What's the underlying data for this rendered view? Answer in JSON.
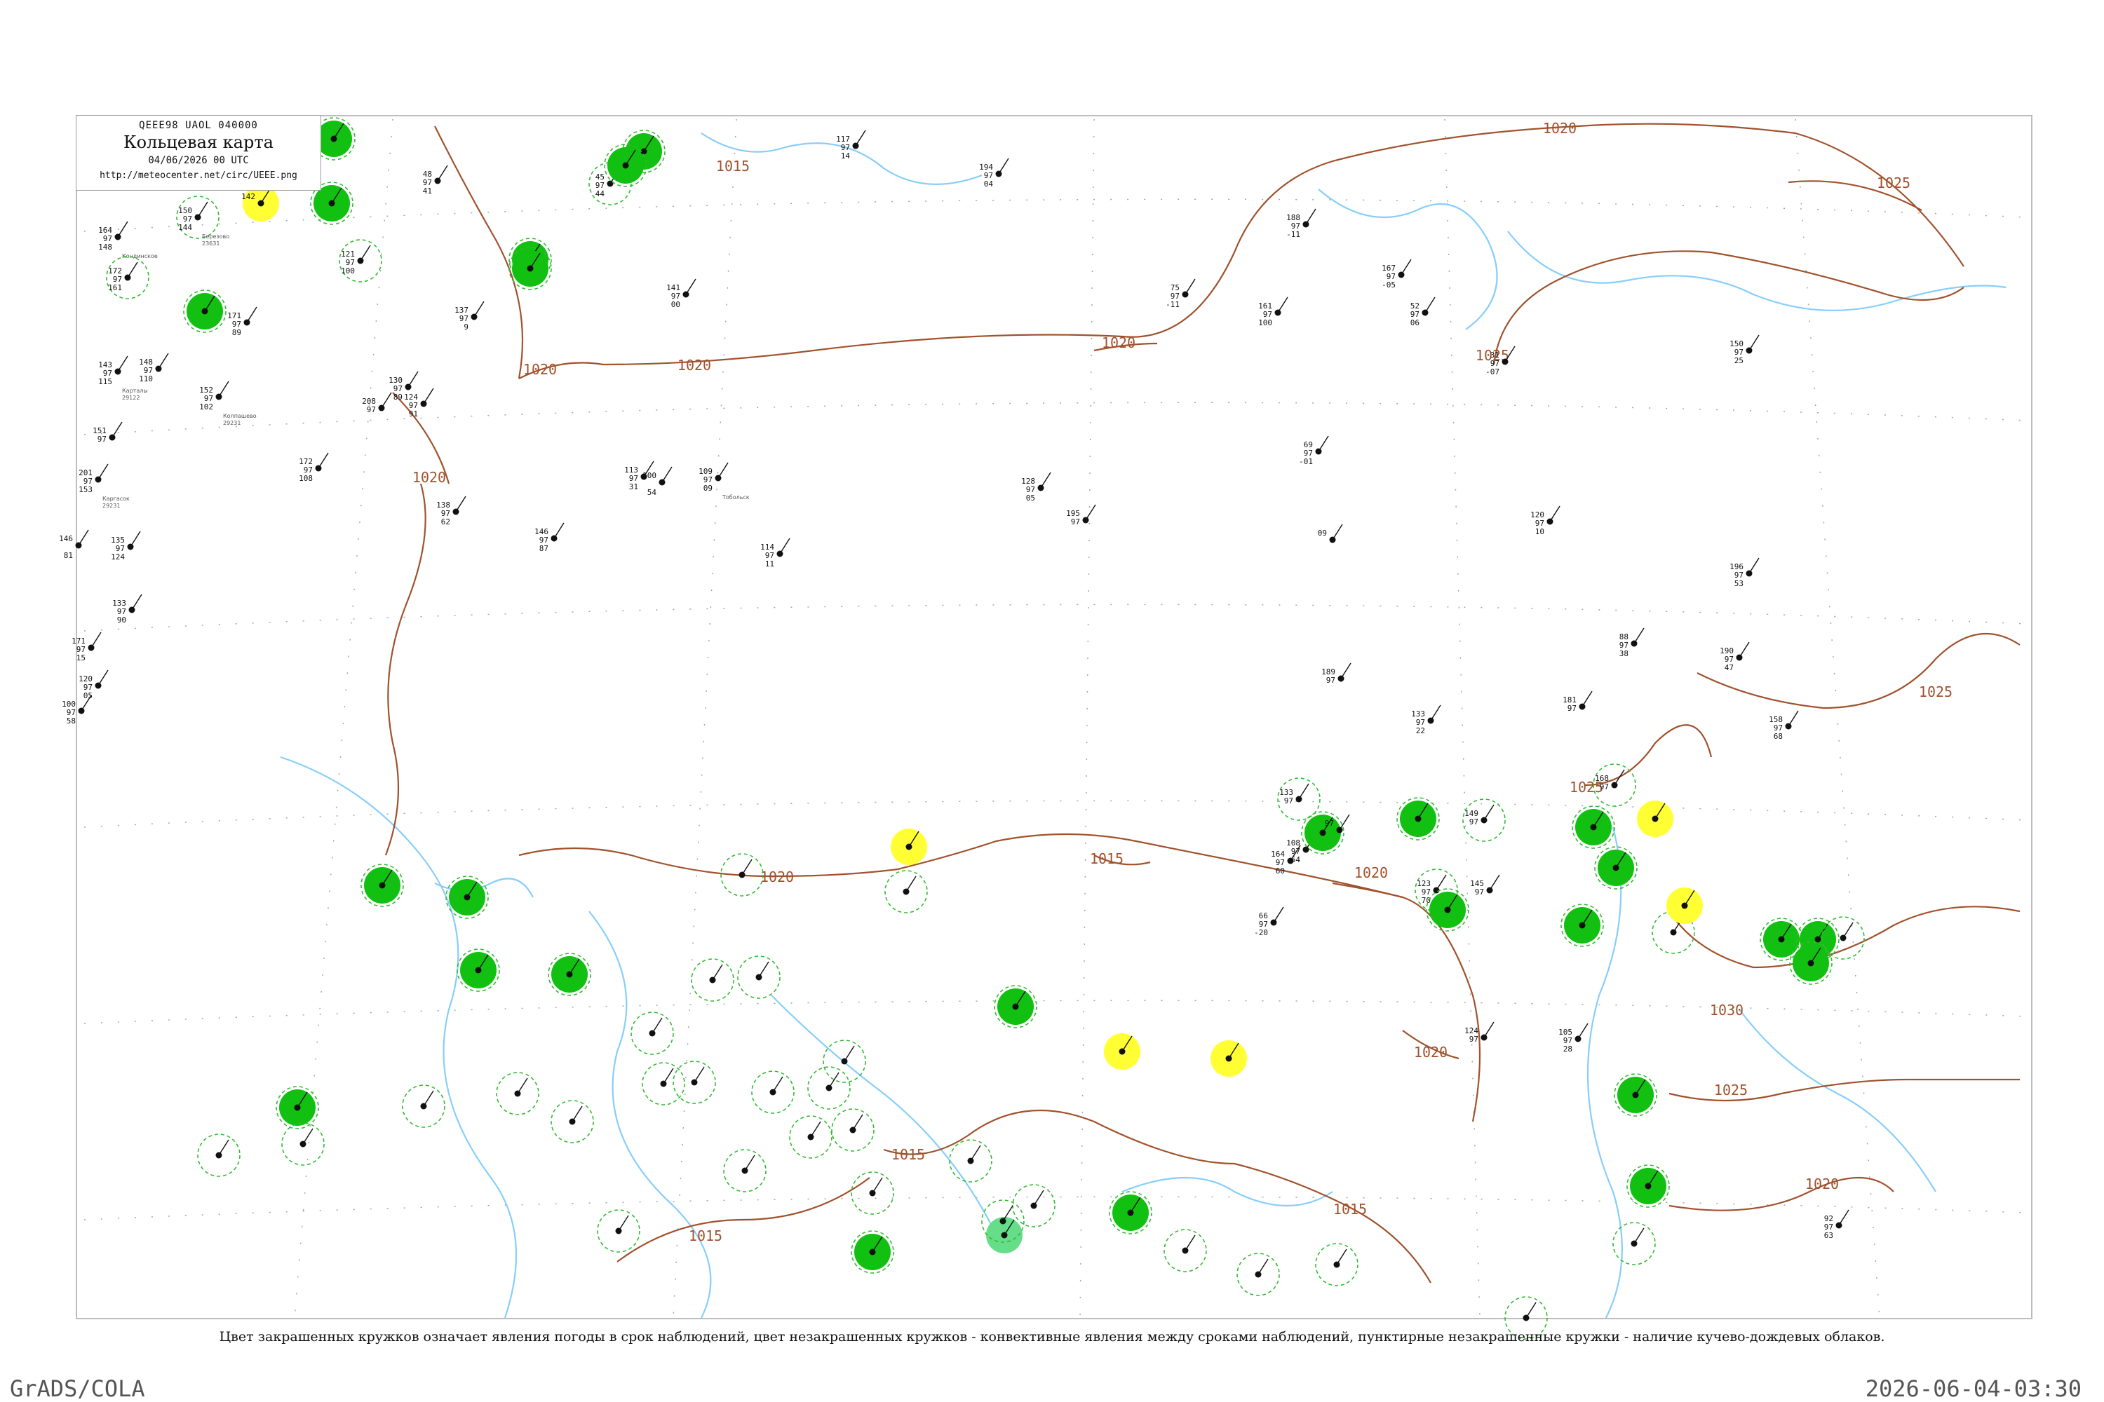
{
  "header": {
    "code": "QEEE98  UAOL  040000",
    "name": "Кольцевая карта",
    "date": "04/06/2026 00 UTC",
    "url": "http://meteocenter.net/circ/UEEE.png"
  },
  "caption": "Цвет закрашенных кружков означает явления погоды в срок наблюдений, цвет незакрашенных кружков - конвективные явления между сроками наблюдений, пунктирные незакрашенные кружки - наличие кучево-дождевых облаков.",
  "footer": {
    "left": "GrADS/COLA",
    "right": "2026-06-04-03:30"
  },
  "colors": {
    "isobar": "#a0522d",
    "river": "#87cefa",
    "rain_fill": "#11c011",
    "fog_fill": "#ffff33",
    "shower_fill": "#66dd88",
    "cb_ring": "#33bb33"
  },
  "isobars": [
    {
      "label": "1015"
    },
    {
      "label": "1020"
    },
    {
      "label": "1020"
    },
    {
      "label": "1020"
    },
    {
      "label": "1020"
    },
    {
      "label": "1020"
    },
    {
      "label": "1025"
    },
    {
      "label": "1025"
    },
    {
      "label": "1025"
    },
    {
      "label": "1025"
    },
    {
      "label": "1030"
    },
    {
      "label": "1025"
    },
    {
      "label": "1020"
    },
    {
      "label": "1020"
    },
    {
      "label": "1015"
    },
    {
      "label": "1015"
    },
    {
      "label": "1020"
    },
    {
      "label": "1015"
    },
    {
      "label": "1015"
    },
    {
      "label": "1020"
    }
  ],
  "stations": [
    {
      "name": "",
      "id": "",
      "t": "142",
      "p": "",
      "dp": "",
      "type": "fog"
    },
    {
      "name": "Березово",
      "id": "23631",
      "t": "150",
      "p": "97",
      "dp": "144",
      "type": "ring"
    },
    {
      "name": "Кондинское",
      "id": "",
      "t": "164",
      "p": "97",
      "dp": "148",
      "type": "none"
    },
    {
      "name": "",
      "id": "",
      "t": "172",
      "p": "97",
      "dp": "161",
      "type": "ring"
    },
    {
      "name": "",
      "id": "",
      "t": "",
      "p": "",
      "dp": "",
      "type": "rain"
    },
    {
      "name": "",
      "id": "",
      "t": "171",
      "p": "97",
      "dp": "89",
      "type": "none"
    },
    {
      "name": "Карталы",
      "id": "29122",
      "t": "143",
      "p": "97",
      "dp": "115",
      "type": "none"
    },
    {
      "name": "",
      "id": "",
      "t": "148",
      "p": "97",
      "dp": "110",
      "type": "none"
    },
    {
      "name": "Колпашево",
      "id": "29231",
      "t": "152",
      "p": "97",
      "dp": "102",
      "type": "none"
    },
    {
      "name": "",
      "id": "",
      "t": "151",
      "p": "97",
      "dp": "",
      "type": "none"
    },
    {
      "name": "Каргасок",
      "id": "29231",
      "t": "201",
      "p": "97",
      "dp": "153",
      "type": "none"
    },
    {
      "name": "",
      "id": "",
      "t": "146",
      "p": "",
      "dp": "81",
      "type": "none"
    },
    {
      "name": "",
      "id": "",
      "t": "135",
      "p": "97",
      "dp": "124",
      "type": "none"
    },
    {
      "name": "",
      "id": "",
      "t": "133",
      "p": "97",
      "dp": "90",
      "type": "none"
    },
    {
      "name": "",
      "id": "",
      "t": "171",
      "p": "97",
      "dp": "15",
      "type": "none"
    },
    {
      "name": "",
      "id": "",
      "t": "120",
      "p": "97",
      "dp": "05",
      "type": "none"
    },
    {
      "name": "",
      "id": "",
      "t": "100",
      "p": "97",
      "dp": "58",
      "type": "none"
    },
    {
      "name": "",
      "id": "",
      "t": "121",
      "p": "97",
      "dp": "100",
      "type": "ring"
    },
    {
      "name": "",
      "id": "",
      "t": "",
      "p": "",
      "dp": "",
      "type": "rain"
    },
    {
      "name": "",
      "id": "",
      "t": "",
      "p": "",
      "dp": "",
      "type": "rain"
    },
    {
      "name": "",
      "id": "",
      "t": "",
      "p": "",
      "dp": "",
      "type": "rain"
    },
    {
      "name": "",
      "id": "",
      "t": "45",
      "p": "97",
      "dp": "44",
      "type": "ring"
    },
    {
      "name": "",
      "id": "",
      "t": "48",
      "p": "97",
      "dp": "41",
      "type": "none"
    },
    {
      "name": "",
      "id": "",
      "t": "137",
      "p": "97",
      "dp": "9",
      "type": "none"
    },
    {
      "name": "",
      "id": "",
      "t": "130",
      "p": "97",
      "dp": "89",
      "type": "none"
    },
    {
      "name": "",
      "id": "",
      "t": "208",
      "p": "97",
      "dp": "",
      "type": "none"
    },
    {
      "name": "",
      "id": "",
      "t": "124",
      "p": "97",
      "dp": "91",
      "type": "none"
    },
    {
      "name": "",
      "id": "",
      "t": "172",
      "p": "97",
      "dp": "108",
      "type": "none"
    },
    {
      "name": "",
      "id": "",
      "t": "138",
      "p": "97",
      "dp": "62",
      "type": "none"
    },
    {
      "name": "",
      "id": "",
      "t": "146",
      "p": "97",
      "dp": "87",
      "type": "none"
    },
    {
      "name": "",
      "id": "",
      "t": "113",
      "p": "97",
      "dp": "31",
      "type": "none"
    },
    {
      "name": "",
      "id": "",
      "t": "100",
      "p": "",
      "dp": "54",
      "type": "none"
    },
    {
      "name": "Тобольск",
      "id": "",
      "t": "109",
      "p": "97",
      "dp": "09",
      "type": "none"
    },
    {
      "name": "",
      "id": "",
      "t": "114",
      "p": "97",
      "dp": "11",
      "type": "none"
    },
    {
      "name": "",
      "id": "",
      "t": "117",
      "p": "97",
      "dp": "14",
      "type": "none"
    },
    {
      "name": "",
      "id": "",
      "t": "194",
      "p": "97",
      "dp": "04",
      "type": "none"
    },
    {
      "name": "",
      "id": "",
      "t": "141",
      "p": "97",
      "dp": "00",
      "type": "none"
    },
    {
      "name": "",
      "id": "",
      "t": "75",
      "p": "97",
      "dp": "-11",
      "type": "none"
    },
    {
      "name": "",
      "id": "",
      "t": "128",
      "p": "97",
      "dp": "05",
      "type": "none"
    },
    {
      "name": "",
      "id": "",
      "t": "195",
      "p": "97",
      "dp": "",
      "type": "none"
    },
    {
      "name": "",
      "id": "",
      "t": "188",
      "p": "97",
      "dp": "-11",
      "type": "none"
    },
    {
      "name": "",
      "id": "",
      "t": "161",
      "p": "97",
      "dp": "100",
      "type": "none"
    },
    {
      "name": "",
      "id": "",
      "t": "66",
      "p": "97",
      "dp": "-20",
      "type": "none"
    },
    {
      "name": "",
      "id": "",
      "t": "167",
      "p": "97",
      "dp": "-05",
      "type": "none"
    },
    {
      "name": "",
      "id": "",
      "t": "52",
      "p": "97",
      "dp": "06",
      "type": "none"
    },
    {
      "name": "",
      "id": "",
      "t": "31",
      "p": "97",
      "dp": "-07",
      "type": "none"
    },
    {
      "name": "",
      "id": "",
      "t": "69",
      "p": "97",
      "dp": "-01",
      "type": "none"
    },
    {
      "name": "",
      "id": "",
      "t": "09",
      "p": "",
      "dp": "",
      "type": "none"
    },
    {
      "name": "",
      "id": "",
      "t": "120",
      "p": "97",
      "dp": "10",
      "type": "none"
    },
    {
      "name": "",
      "id": "",
      "t": "150",
      "p": "97",
      "dp": "25",
      "type": "none"
    },
    {
      "name": "",
      "id": "",
      "t": "196",
      "p": "97",
      "dp": "53",
      "type": "none"
    },
    {
      "name": "",
      "id": "",
      "t": "88",
      "p": "97",
      "dp": "38",
      "type": "none"
    },
    {
      "name": "",
      "id": "",
      "t": "190",
      "p": "97",
      "dp": "47",
      "type": "none"
    },
    {
      "name": "",
      "id": "",
      "t": "158",
      "p": "97",
      "dp": "68",
      "type": "none"
    },
    {
      "name": "",
      "id": "",
      "t": "189",
      "p": "97",
      "dp": "",
      "type": "none"
    },
    {
      "name": "",
      "id": "",
      "t": "133",
      "p": "97",
      "dp": "22",
      "type": "none"
    },
    {
      "name": "",
      "id": "",
      "t": "181",
      "p": "97",
      "dp": "",
      "type": "none"
    },
    {
      "name": "",
      "id": "",
      "t": "168",
      "p": "97",
      "dp": "",
      "type": "ring"
    },
    {
      "name": "",
      "id": "",
      "t": "",
      "p": "",
      "dp": "",
      "type": "rain"
    },
    {
      "name": "",
      "id": "",
      "t": "",
      "p": "",
      "dp": "",
      "type": "rain"
    },
    {
      "name": "",
      "id": "",
      "t": "",
      "p": "",
      "dp": "",
      "type": "rain"
    },
    {
      "name": "",
      "id": "",
      "t": "149",
      "p": "97",
      "dp": "",
      "type": "ring"
    },
    {
      "name": "",
      "id": "",
      "t": "145",
      "p": "97",
      "dp": "",
      "type": "none"
    },
    {
      "name": "",
      "id": "",
      "t": "123",
      "p": "97",
      "dp": "70",
      "type": "ring"
    },
    {
      "name": "",
      "id": "",
      "t": "",
      "p": "",
      "dp": "",
      "type": "rain"
    },
    {
      "name": "",
      "id": "",
      "t": "133",
      "p": "97",
      "dp": "",
      "type": "ring"
    },
    {
      "name": "",
      "id": "",
      "t": "164",
      "p": "97",
      "dp": "60",
      "type": "none"
    },
    {
      "name": "",
      "id": "",
      "t": "108",
      "p": "97",
      "dp": "64",
      "type": "none"
    },
    {
      "name": "",
      "id": "",
      "t": "",
      "p": "",
      "dp": "",
      "type": "rain"
    },
    {
      "name": "",
      "id": "",
      "t": "97",
      "p": "",
      "dp": "",
      "type": "none"
    },
    {
      "name": "",
      "id": "",
      "t": "",
      "p": "",
      "dp": "",
      "type": "rain"
    },
    {
      "name": "",
      "id": "",
      "t": "",
      "p": "",
      "dp": "",
      "type": "ring"
    },
    {
      "name": "",
      "id": "",
      "t": "",
      "p": "",
      "dp": "",
      "type": "rain"
    },
    {
      "name": "",
      "id": "",
      "t": "",
      "p": "",
      "dp": "",
      "type": "rain"
    },
    {
      "name": "",
      "id": "",
      "t": "",
      "p": "",
      "dp": "",
      "type": "rain"
    },
    {
      "name": "",
      "id": "",
      "t": "",
      "p": "",
      "dp": "",
      "type": "rain"
    },
    {
      "name": "",
      "id": "",
      "t": "",
      "p": "",
      "dp": "",
      "type": "rain"
    },
    {
      "name": "",
      "id": "",
      "t": "92",
      "p": "97",
      "dp": "63",
      "type": "none"
    },
    {
      "name": "",
      "id": "",
      "t": "105",
      "p": "97",
      "dp": "28",
      "type": "none"
    },
    {
      "name": "",
      "id": "",
      "t": "124",
      "p": "97",
      "dp": "",
      "type": "none"
    },
    {
      "name": "",
      "id": "",
      "t": "",
      "p": "",
      "dp": "",
      "type": "fog"
    },
    {
      "name": "",
      "id": "",
      "t": "",
      "p": "",
      "dp": "",
      "type": "fog"
    },
    {
      "name": "",
      "id": "",
      "t": "",
      "p": "",
      "dp": "",
      "type": "fog"
    },
    {
      "name": "",
      "id": "",
      "t": "",
      "p": "",
      "dp": "",
      "type": "fog"
    },
    {
      "name": "",
      "id": "",
      "t": "",
      "p": "",
      "dp": "",
      "type": "fog"
    },
    {
      "name": "",
      "id": "",
      "t": "",
      "p": "",
      "dp": "",
      "type": "rain"
    },
    {
      "name": "",
      "id": "",
      "t": "",
      "p": "",
      "dp": "",
      "type": "rain"
    },
    {
      "name": "",
      "id": "",
      "t": "",
      "p": "",
      "dp": "",
      "type": "rain"
    },
    {
      "name": "",
      "id": "",
      "t": "",
      "p": "",
      "dp": "",
      "type": "rain"
    },
    {
      "name": "",
      "id": "",
      "t": "",
      "p": "",
      "dp": "",
      "type": "rain"
    },
    {
      "name": "",
      "id": "",
      "t": "",
      "p": "",
      "dp": "",
      "type": "rain"
    },
    {
      "name": "",
      "id": "",
      "t": "",
      "p": "",
      "dp": "",
      "type": "rain"
    },
    {
      "name": "",
      "id": "",
      "t": "",
      "p": "",
      "dp": "",
      "type": "rain"
    },
    {
      "name": "",
      "id": "",
      "t": "",
      "p": "",
      "dp": "",
      "type": "rain"
    },
    {
      "name": "",
      "id": "",
      "t": "",
      "p": "",
      "dp": "",
      "type": "rain"
    },
    {
      "name": "",
      "id": "",
      "t": "",
      "p": "",
      "dp": "",
      "type": "rain"
    },
    {
      "name": "",
      "id": "",
      "t": "",
      "p": "",
      "dp": "",
      "type": "shower"
    },
    {
      "name": "",
      "id": "",
      "t": "",
      "p": "",
      "dp": "",
      "type": "ring"
    },
    {
      "name": "",
      "id": "",
      "t": "",
      "p": "",
      "dp": "",
      "type": "ring"
    },
    {
      "name": "",
      "id": "",
      "t": "",
      "p": "",
      "dp": "",
      "type": "ring"
    },
    {
      "name": "",
      "id": "",
      "t": "",
      "p": "",
      "dp": "",
      "type": "ring"
    },
    {
      "name": "",
      "id": "",
      "t": "",
      "p": "",
      "dp": "",
      "type": "ring"
    },
    {
      "name": "",
      "id": "",
      "t": "",
      "p": "",
      "dp": "",
      "type": "ring"
    },
    {
      "name": "",
      "id": "",
      "t": "",
      "p": "",
      "dp": "",
      "type": "ring"
    },
    {
      "name": "",
      "id": "",
      "t": "",
      "p": "",
      "dp": "",
      "type": "ring"
    },
    {
      "name": "",
      "id": "",
      "t": "",
      "p": "",
      "dp": "",
      "type": "ring"
    },
    {
      "name": "",
      "id": "",
      "t": "",
      "p": "",
      "dp": "",
      "type": "ring"
    },
    {
      "name": "",
      "id": "",
      "t": "",
      "p": "",
      "dp": "",
      "type": "ring"
    },
    {
      "name": "",
      "id": "",
      "t": "",
      "p": "",
      "dp": "",
      "type": "ring"
    },
    {
      "name": "",
      "id": "",
      "t": "",
      "p": "",
      "dp": "",
      "type": "ring"
    },
    {
      "name": "",
      "id": "",
      "t": "",
      "p": "",
      "dp": "",
      "type": "ring"
    },
    {
      "name": "",
      "id": "",
      "t": "",
      "p": "",
      "dp": "",
      "type": "ring"
    },
    {
      "name": "",
      "id": "",
      "t": "",
      "p": "",
      "dp": "",
      "type": "ring"
    },
    {
      "name": "",
      "id": "",
      "t": "",
      "p": "",
      "dp": "",
      "type": "ring"
    },
    {
      "name": "",
      "id": "",
      "t": "",
      "p": "",
      "dp": "",
      "type": "ring"
    },
    {
      "name": "",
      "id": "",
      "t": "",
      "p": "",
      "dp": "",
      "type": "ring"
    },
    {
      "name": "",
      "id": "",
      "t": "",
      "p": "",
      "dp": "",
      "type": "ring"
    },
    {
      "name": "",
      "id": "",
      "t": "",
      "p": "",
      "dp": "",
      "type": "ring"
    },
    {
      "name": "",
      "id": "",
      "t": "",
      "p": "",
      "dp": "",
      "type": "ring"
    },
    {
      "name": "",
      "id": "",
      "t": "",
      "p": "",
      "dp": "",
      "type": "ring"
    },
    {
      "name": "",
      "id": "",
      "t": "",
      "p": "",
      "dp": "",
      "type": "ring"
    },
    {
      "name": "",
      "id": "",
      "t": "",
      "p": "",
      "dp": "",
      "type": "ring"
    },
    {
      "name": "",
      "id": "",
      "t": "",
      "p": "",
      "dp": "",
      "type": "ring"
    },
    {
      "name": "",
      "id": "",
      "t": "",
      "p": "",
      "dp": "",
      "type": "ring"
    },
    {
      "name": "",
      "id": "",
      "t": "",
      "p": "",
      "dp": "",
      "type": "ring"
    },
    {
      "name": "",
      "id": "",
      "t": "",
      "p": "",
      "dp": "",
      "type": "ring"
    }
  ]
}
